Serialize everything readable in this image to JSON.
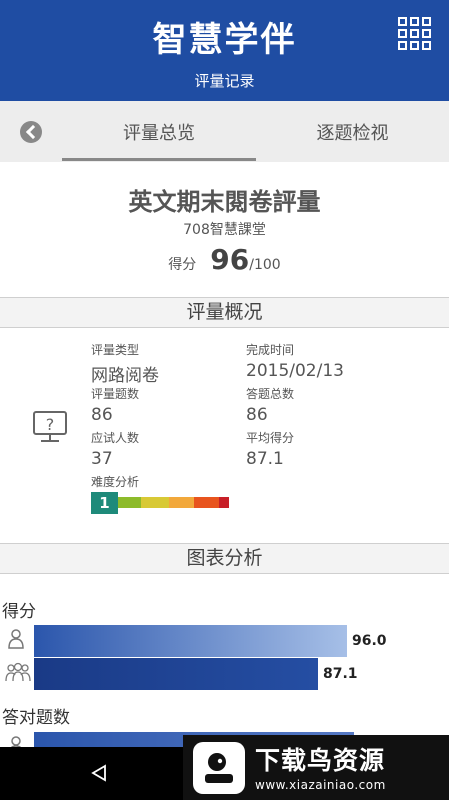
{
  "header": {
    "app_title": "智慧学伴",
    "subtitle": "评量记录"
  },
  "tabs": [
    {
      "label": "评量总览"
    },
    {
      "label": "逐题检视"
    }
  ],
  "exam": {
    "title": "英文期末閱卷評量",
    "class_name": "708智慧課堂",
    "score_label": "得分",
    "score": "96",
    "score_total": "/100"
  },
  "overview": {
    "section_title": "评量概况",
    "type_label": "评量类型",
    "type_value": "网路阅卷",
    "time_label": "完成时间",
    "time_value": "2015/02/13",
    "count_label": "评量题数",
    "count_value": "86",
    "answered_label": "答题总数",
    "answered_value": "86",
    "examinees_label": "应试人数",
    "examinees_value": "37",
    "avg_label": "平均得分",
    "avg_value": "87.1",
    "difficulty_label": "难度分析",
    "difficulty_level": "1",
    "difficulty_colors": [
      "#8dbb2a",
      "#d8c935",
      "#f2a83b",
      "#e8541e",
      "#c81f28"
    ]
  },
  "chart": {
    "section_title": "图表分析",
    "groups": [
      {
        "label": "得分",
        "personal_value": "96.0",
        "average_value": "87.1"
      },
      {
        "label": "答对题数"
      }
    ]
  },
  "chart_data": {
    "type": "bar",
    "categories": [
      "得分"
    ],
    "series": [
      {
        "values": [
          96.0
        ]
      },
      {
        "values": [
          87.1
        ]
      }
    ],
    "xlim": [
      0,
      100
    ],
    "colors": [
      "#3d66b6",
      "#1f3f8f"
    ]
  },
  "ad": {
    "title": "下载鸟资源",
    "url": "www.xiazainiao.com"
  }
}
